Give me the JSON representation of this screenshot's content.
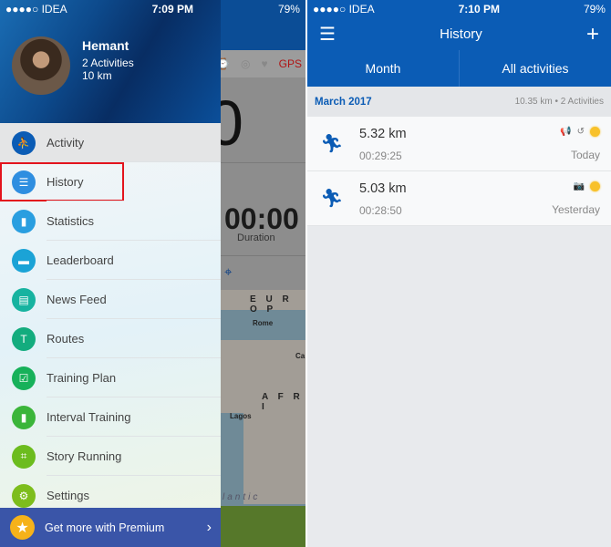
{
  "left_screen": {
    "status": {
      "carrier": "●●●●○ IDEA",
      "time": "7:09 PM",
      "battery": "79%"
    },
    "background_app": {
      "gps": "GPS",
      "value": "0",
      "duration_value": "00:00",
      "duration_label": "Duration",
      "map_labels": [
        "E U R O P",
        "Rome",
        "A F R I",
        "Lagos",
        "Ca",
        "lantic"
      ]
    },
    "drawer": {
      "user": {
        "name": "Hemant",
        "activities": "2 Activities",
        "distance": "10 km"
      },
      "items": [
        {
          "label": "Activity",
          "icon": "running-icon",
          "color": "#0b5cb5"
        },
        {
          "label": "History",
          "icon": "list-icon",
          "color": "#2f8ee0",
          "highlighted": true
        },
        {
          "label": "Statistics",
          "icon": "bar-chart-icon",
          "color": "#2a9ee0"
        },
        {
          "label": "Leaderboard",
          "icon": "podium-icon",
          "color": "#1ba3d6"
        },
        {
          "label": "News Feed",
          "icon": "newsfeed-icon",
          "color": "#17b3a0"
        },
        {
          "label": "Routes",
          "icon": "signpost-icon",
          "color": "#13ac7e"
        },
        {
          "label": "Training Plan",
          "icon": "clipboard-check-icon",
          "color": "#17b15a"
        },
        {
          "label": "Interval Training",
          "icon": "bars-icon",
          "color": "#3bb53a"
        },
        {
          "label": "Story Running",
          "icon": "focus-icon",
          "color": "#6cbc1e"
        },
        {
          "label": "Settings",
          "icon": "gear-icon",
          "color": "#7dbd1c"
        }
      ],
      "premium": {
        "label": "Get more with Premium",
        "color": "#3a55a8"
      }
    }
  },
  "right_screen": {
    "status": {
      "carrier": "●●●●○ IDEA",
      "time": "7:10 PM",
      "battery": "79%"
    },
    "nav": {
      "title": "History"
    },
    "tabs": [
      {
        "label": "Month"
      },
      {
        "label": "All activities"
      }
    ],
    "section": {
      "month": "March 2017",
      "summary": "10.35 km • 2 Activities"
    },
    "activities": [
      {
        "distance": "5.32 km",
        "duration": "00:29:25",
        "day": "Today",
        "icons": [
          "megaphone-icon",
          "arm-icon",
          "sun-icon"
        ]
      },
      {
        "distance": "5.03 km",
        "duration": "00:28:50",
        "day": "Yesterday",
        "icons": [
          "camera-icon",
          "sun-icon"
        ]
      }
    ]
  }
}
